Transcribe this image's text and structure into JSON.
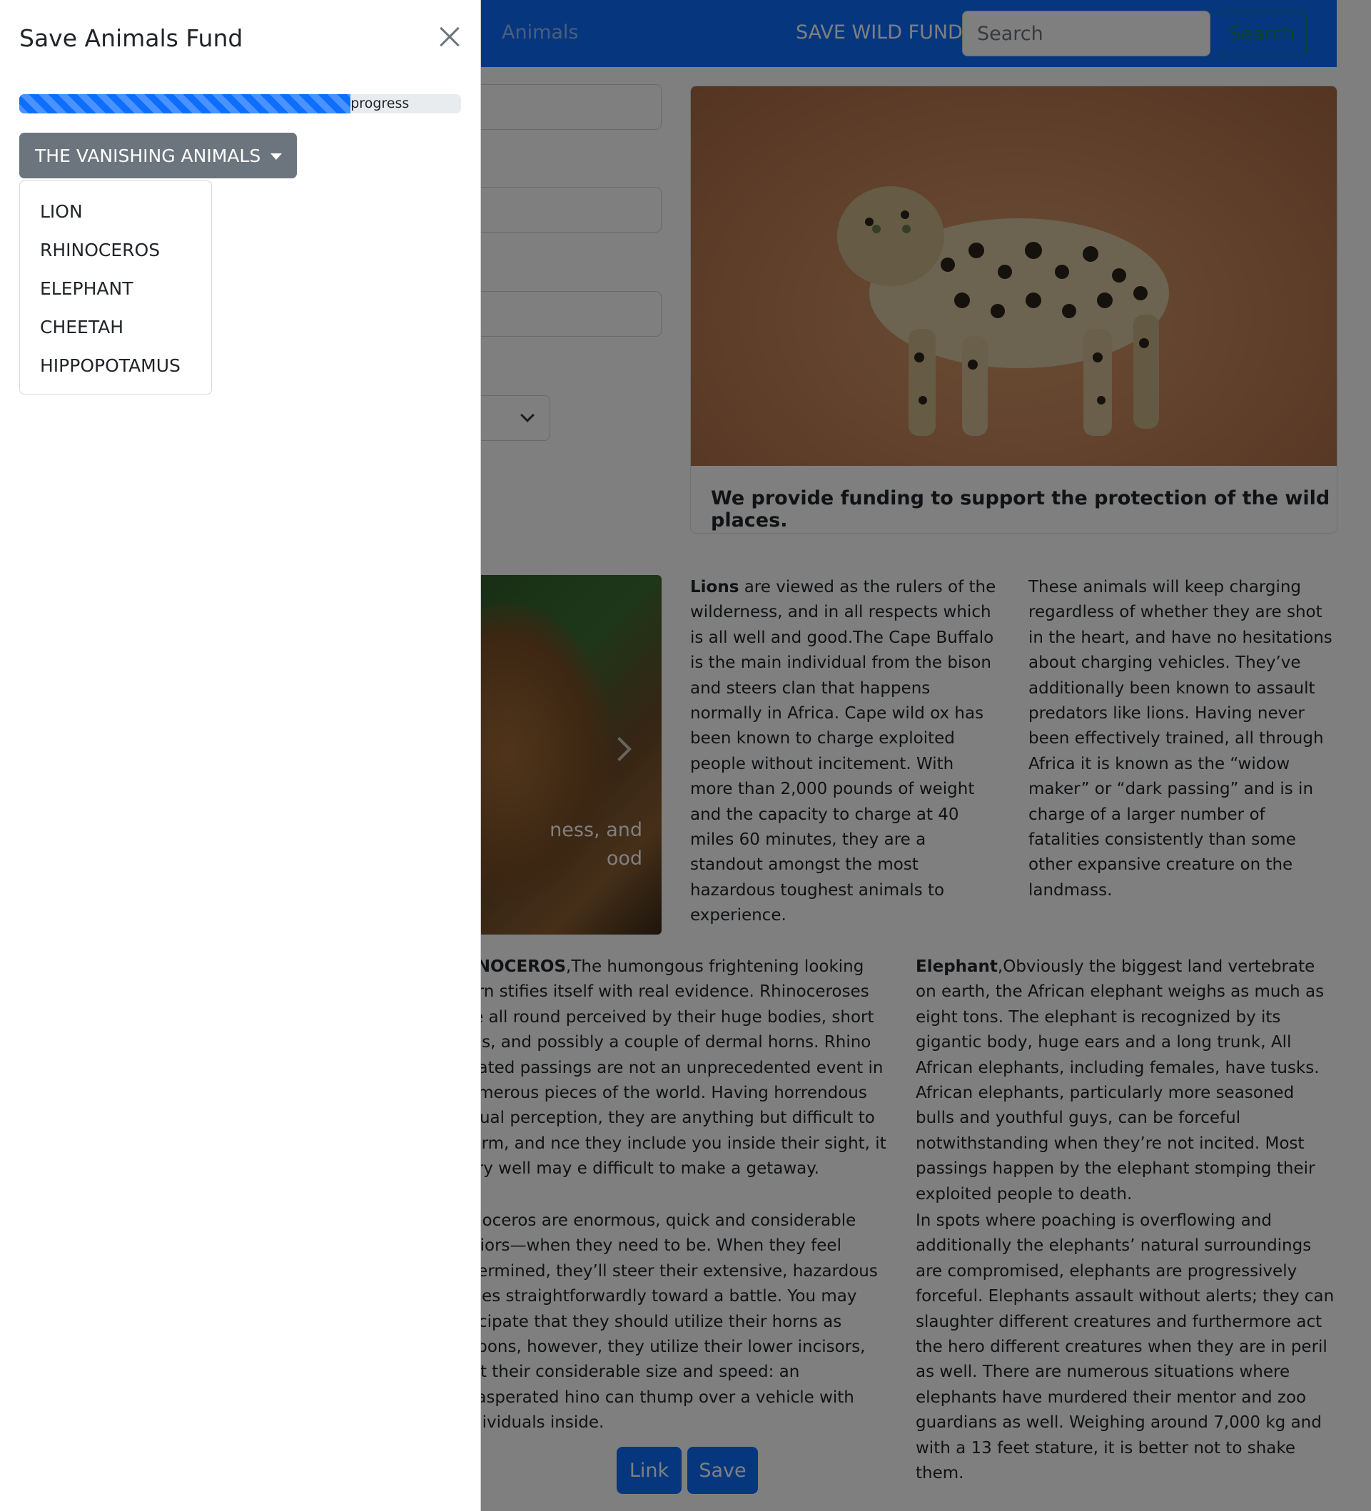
{
  "navbar": {
    "nav_link": "Animals",
    "brand": "SAVE WILD FUND",
    "search_placeholder": "Search",
    "search_button": "Search"
  },
  "featured_card": {
    "text": "We provide funding to support the protection of the wild places."
  },
  "carousel": {
    "caption_line1": "ness, and",
    "caption_line2": "ood"
  },
  "articles": {
    "lions": {
      "title": "Lions",
      "body": " are viewed as the rulers of the wilderness, and in all respects which is all well and good.The Cape Buffalo is the main individual from the bison and steers clan that happens normally in Africa. Cape wild ox has been known to charge exploited people without incitement. With more than 2,000 pounds of weight and the capacity to charge at 40 miles 60 minutes, they are a standout amongst the most hazardous toughest animals to experience."
    },
    "charging": {
      "body": "These animals will keep charging regardless of whether they are shot in the heart, and have no hesitations about charging vehicles. They’ve additionally been known to assault predators like lions. Having never been effectively trained, all through Africa it is known as the “widow maker” or “dark passing” and is in charge of a larger number of fatalities consistently than some other expansive creature on the landmass."
    },
    "rhino": {
      "title": "HINOCEROS",
      "body": ",The humongous frightening looking horn stifies itself with real evidence. Rhinoceroses are all round perceived by their huge bodies, short legs, and possibly a couple of dermal horns. Rhino related passings are not an unprecedented event in numerous pieces of the world. Having horrendous visual perception, they are anything but difficult to alarm, and nce they include you inside their sight, it very well may e difficult to make a getaway."
    },
    "rhino2": {
      "body": "hinoceros are enormous, quick and considerable arriors—when they need to be. When they feel ndermined, they’ll steer their extensive, hazardous odies straightforwardly toward a battle. You may nticipate that they should utilize their horns as eapons, however, they utilize their lower incisors, just their considerable size and speed: an exasperated hino can thump over a vehicle with individuals inside."
    },
    "elephant": {
      "title": "Elephant",
      "body": ",Obviously the biggest land vertebrate on earth, the African elephant weighs as much as eight tons. The elephant is recognized by its gigantic body, huge ears and a long trunk, All African elephants, including females, have tusks. African elephants, particularly more seasoned bulls and youthful guys, can be forceful notwithstanding when they’re not incited. Most passings happen by the elephant stomping their exploited people to death."
    },
    "elephant2": {
      "body": "In spots where poaching is overflowing and additionally the elephants’ natural surroundings are compromised, elephants are progressively forceful. Elephants assault without alerts; they can slaughter different creatures and furthermore act the hero different creatures when they are in peril as well. There are numerous situations where elephants have murdered their mentor and zoo guardians as well. Weighing around 7,000 kg and with a 13 feet stature, it is better not to shake them."
    }
  },
  "buttons": {
    "link": "Link",
    "save": "Save"
  },
  "offcanvas": {
    "title": "Save Animals Fund",
    "close_icon": "close-icon",
    "progress": {
      "value_percent": 75,
      "label": "progress"
    },
    "dropdown": {
      "toggle_label": "THE VANISHING ANIMALS",
      "items": [
        "LION",
        "RHINOCEROS",
        "ELEPHANT",
        "CHEETAH",
        "HIPPOPOTAMUS"
      ]
    }
  },
  "colors": {
    "primary": "#0d6efd",
    "secondary": "#6c757d",
    "success": "#198754",
    "backdrop": "rgba(0,0,0,0.5)"
  }
}
